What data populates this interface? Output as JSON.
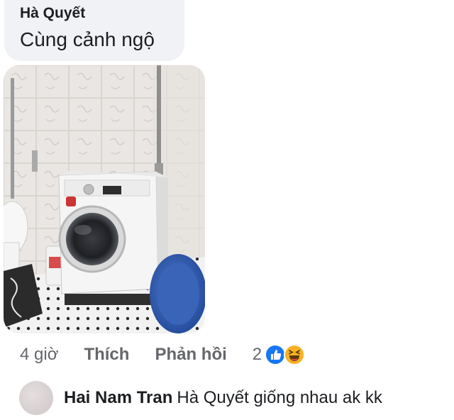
{
  "comment": {
    "author": "Hà Quyết",
    "text": "Cùng cảnh ngộ",
    "bubble_color": "#f0f2f5"
  },
  "photo": {
    "description_icon": "washing-machine-photo"
  },
  "actions": {
    "time": "4 giờ",
    "like_label": "Thích",
    "reply_label": "Phản hồi",
    "reaction_count": "2",
    "reaction_icons": [
      "like-reaction-icon",
      "haha-reaction-icon"
    ],
    "text_color": "#65676b"
  },
  "reply": {
    "author": "Hai Nam Tran",
    "text": "Hà Quyết giống nhau ak kk"
  }
}
